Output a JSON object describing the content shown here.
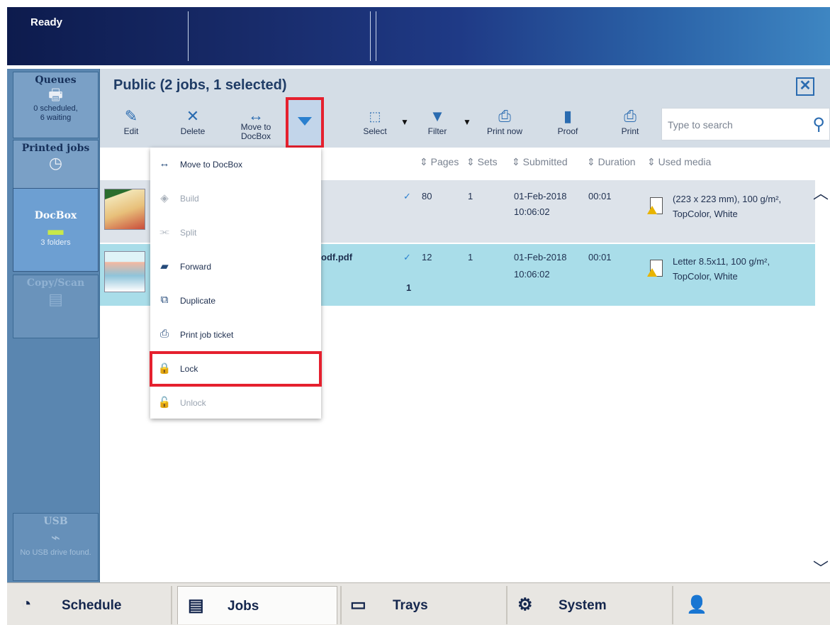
{
  "status": {
    "text": "Ready"
  },
  "sidebar": {
    "queues": {
      "title": "Queues",
      "sub1": "0 scheduled,",
      "sub2": "6 waiting"
    },
    "printed": {
      "title": "Printed jobs"
    },
    "docbox": {
      "title": "DocBox",
      "sub": "3 folders"
    },
    "copyscan": {
      "title": "Copy/Scan"
    },
    "usb": {
      "title": "USB",
      "sub": "No USB drive found."
    }
  },
  "header": {
    "title": "Public (2 jobs, 1 selected)"
  },
  "toolbar": {
    "edit": "Edit",
    "delete": "Delete",
    "move1": "Move to",
    "move2": "DocBox",
    "select": "Select",
    "filter": "Filter",
    "print_now": "Print now",
    "proof": "Proof",
    "print": "Print",
    "search_placeholder": "Type to search"
  },
  "table": {
    "headers": {
      "pages": "Pages",
      "sets": "Sets",
      "submitted": "Submitted",
      "duration": "Duration",
      "media": "Used media"
    },
    "rows": [
      {
        "name": "",
        "pages": "80",
        "sets": "1",
        "date": "01-Feb-2018",
        "time": "10:06:02",
        "duration": "00:01",
        "media1": "(223 x 223 mm), 100 g/m²,",
        "media2": "TopColor, White",
        "extra": ""
      },
      {
        "name": "odf.pdf",
        "pages": "12",
        "sets": "1",
        "date": "01-Feb-2018",
        "time": "10:06:02",
        "duration": "00:01",
        "media1": "Letter 8.5x11, 100 g/m²,",
        "media2": "TopColor, White",
        "extra": "1"
      }
    ]
  },
  "menu": {
    "items": [
      {
        "label": "Move to DocBox",
        "enabled": true
      },
      {
        "label": "Build",
        "enabled": false
      },
      {
        "label": "Split",
        "enabled": false
      },
      {
        "label": "Forward",
        "enabled": true
      },
      {
        "label": "Duplicate",
        "enabled": true
      },
      {
        "label": "Print job ticket",
        "enabled": true
      },
      {
        "label": "Lock",
        "enabled": true,
        "highlighted": true
      },
      {
        "label": "Unlock",
        "enabled": false
      }
    ]
  },
  "nav": {
    "schedule": "Schedule",
    "jobs": "Jobs",
    "trays": "Trays",
    "system": "System"
  },
  "colors": {
    "accent": "#2a6bb0",
    "highlight": "#e5202e",
    "selected_row": "#a9dde9"
  }
}
